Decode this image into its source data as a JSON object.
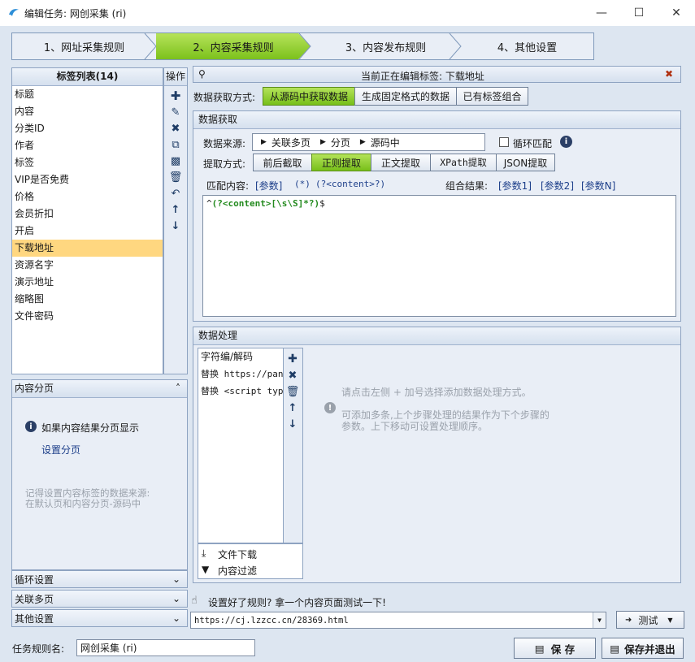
{
  "window": {
    "title": "编辑任务: 网创采集 (ri)"
  },
  "steps": [
    {
      "label": "1、网址采集规则"
    },
    {
      "label": "2、内容采集规则"
    },
    {
      "label": "3、内容发布规则"
    },
    {
      "label": "4、其他设置"
    }
  ],
  "tag_list": {
    "title": "标签列表(14)",
    "ops_label": "操作",
    "items": [
      "标题",
      "内容",
      "分类ID",
      "作者",
      "标签",
      "VIP是否免费",
      "价格",
      "会员折扣",
      "开启",
      "下载地址",
      "资源名字",
      "演示地址",
      "缩略图",
      "文件密码"
    ],
    "selected_index": 9
  },
  "content_paging": {
    "title": "内容分页",
    "info": "如果内容结果分页显示",
    "link": "设置分页",
    "note_line1": "记得设置内容标签的数据来源:",
    "note_line2": "在默认页和内容分页-源码中"
  },
  "collapsibles": {
    "loop": "循环设置",
    "related": "关联多页",
    "other": "其他设置"
  },
  "editing": {
    "header": "当前正在编辑标签: 下载地址",
    "acquire_mode_label": "数据获取方式:",
    "mode_buttons": [
      "从源码中获取数据",
      "生成固定格式的数据",
      "已有标签组合"
    ]
  },
  "data_fetch": {
    "title": "数据获取",
    "source_label": "数据来源:",
    "source_path": [
      "关联多页",
      "分页",
      "源码中"
    ],
    "loop_match_label": "循环匹配",
    "method_label": "提取方式:",
    "methods": [
      "前后截取",
      "正则提取",
      "正文提取",
      "XPath提取",
      "JSON提取"
    ],
    "match_label": "匹配内容:",
    "match_tokens": [
      "[参数]",
      "(*)",
      "(?<content>?)"
    ],
    "combine_label": "组合结果:",
    "combine_tokens": [
      "[参数1]",
      "[参数2]",
      "[参数N]"
    ],
    "regex_prefix": "^",
    "regex_body": "(?<content>[\\s\\S]*?)",
    "regex_suffix": "$"
  },
  "processing": {
    "title": "数据处理",
    "items": [
      "字符编/解码",
      "替换 https://pan",
      "替换 <script  typ"
    ],
    "bottom_items": [
      "文件下载",
      "内容过滤"
    ],
    "hint1": "请点击左侧 + 加号选择添加数据处理方式。",
    "hint2_line1": "可添加多条,上个步骤处理的结果作为下个步骤的",
    "hint2_line2": "参数。上下移动可设置处理顺序。"
  },
  "test": {
    "prompt": "设置好了规则? 拿一个内容页面测试一下!",
    "url": "https://cj.lzzcc.cn/28369.html",
    "button": "测试"
  },
  "footer": {
    "task_name_label": "任务规则名:",
    "task_name": "网创采集 (ri)",
    "save": "保 存",
    "save_exit": "保存并退出"
  },
  "colors": {
    "accent_green": "#7cc11c",
    "selected_row": "#ffd780",
    "client_bg": "#dde6f1"
  }
}
